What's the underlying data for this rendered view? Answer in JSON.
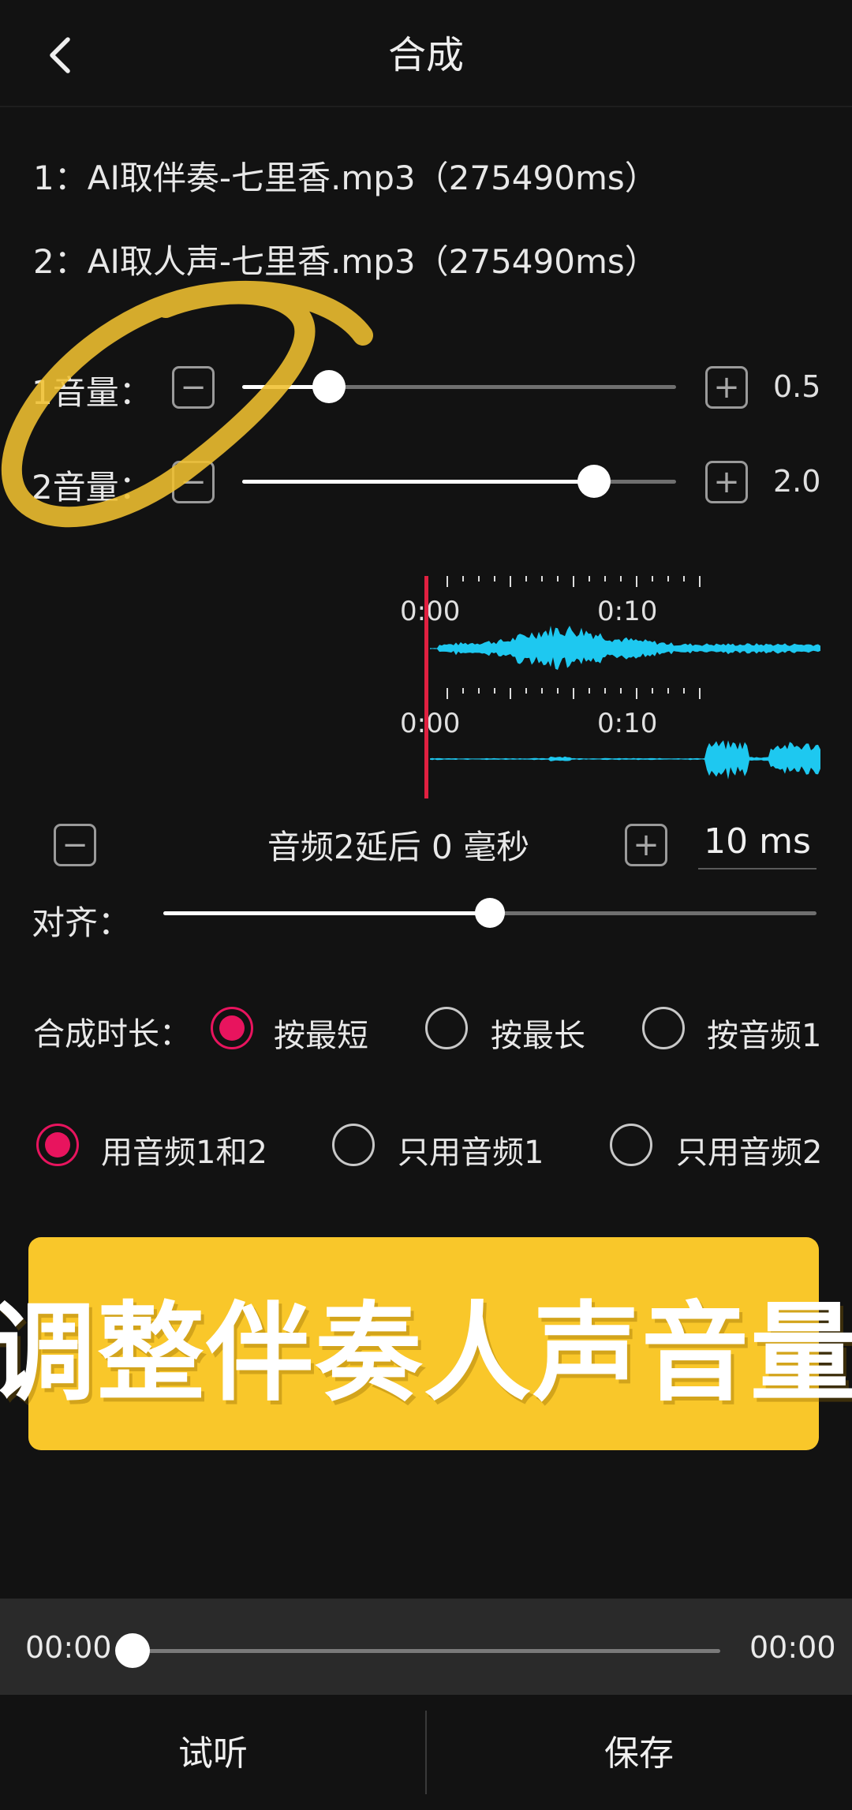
{
  "header": {
    "title": "合成"
  },
  "files": [
    "1：AI取伴奏-七里香.mp3（275490ms）",
    "2：AI取人声-七里香.mp3（275490ms）"
  ],
  "volume1": {
    "label": "1音量：",
    "value_text": "0.5",
    "level": 0.2
  },
  "volume2": {
    "label": "2音量：",
    "value_text": "2.0",
    "level": 0.81
  },
  "waveform": {
    "track1": {
      "start_label": "0:00",
      "mid_label": "0:10"
    },
    "track2": {
      "start_label": "0:00",
      "mid_label": "0:10"
    }
  },
  "delay": {
    "text": "音频2延后 0 毫秒",
    "step_value": "10 ms"
  },
  "align": {
    "label": "对齐：",
    "position": 0.5
  },
  "duration": {
    "label": "合成时长：",
    "options": [
      {
        "label": "按最短",
        "selected": true
      },
      {
        "label": "按最长",
        "selected": false
      },
      {
        "label": "按音频1",
        "selected": false
      }
    ]
  },
  "mix": {
    "options": [
      {
        "label": "用音频1和2",
        "selected": true
      },
      {
        "label": "只用音频1",
        "selected": false
      },
      {
        "label": "只用音频2",
        "selected": false
      }
    ]
  },
  "banner": {
    "text": "调整伴奏人声音量"
  },
  "player": {
    "current_time": "00:00",
    "total_time": "00:00",
    "progress": 0
  },
  "bottom": {
    "preview_label": "试听",
    "save_label": "保存"
  },
  "colors": {
    "accent": "#e8145e",
    "waveform": "#1ec8f0",
    "playhead": "#e02040",
    "banner": "#f9c72a",
    "highlight_circle": "#f0c030"
  }
}
